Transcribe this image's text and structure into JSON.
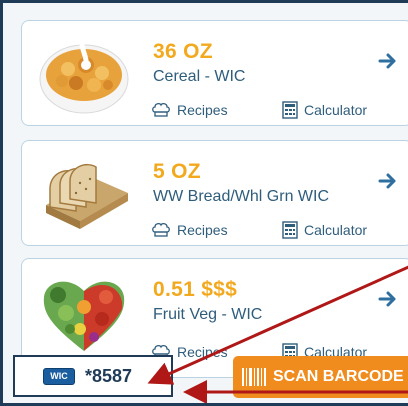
{
  "products": [
    {
      "size": "36 OZ",
      "name": "Cereal - WIC",
      "recipes_label": "Recipes",
      "calculator_label": "Calculator",
      "image": "cereal-bowl"
    },
    {
      "size": "5 OZ",
      "name": "WW Bread/Whl Grn WIC",
      "recipes_label": "Recipes",
      "calculator_label": "Calculator",
      "image": "bread-loaf"
    },
    {
      "size": "0.51 $$$",
      "name": "Fruit Veg - WIC",
      "recipes_label": "Recipes",
      "calculator_label": "Calculator",
      "image": "fruit-veg-heart"
    }
  ],
  "wic": {
    "badge": "WIC",
    "card_number": "*8587"
  },
  "scan": {
    "label": "SCAN BARCODE"
  },
  "colors": {
    "accent": "#f2a91d",
    "text": "#2f5d7c",
    "card_border": "#bcd3e4",
    "scan_button": "#f08b1e",
    "annotation_arrow": "#b01818"
  },
  "icons": {
    "detail": "arrow-right-icon",
    "recipes": "chef-hat-icon",
    "calculator": "calculator-icon",
    "wic_card": "card-icon",
    "scan": "barcode-icon"
  }
}
